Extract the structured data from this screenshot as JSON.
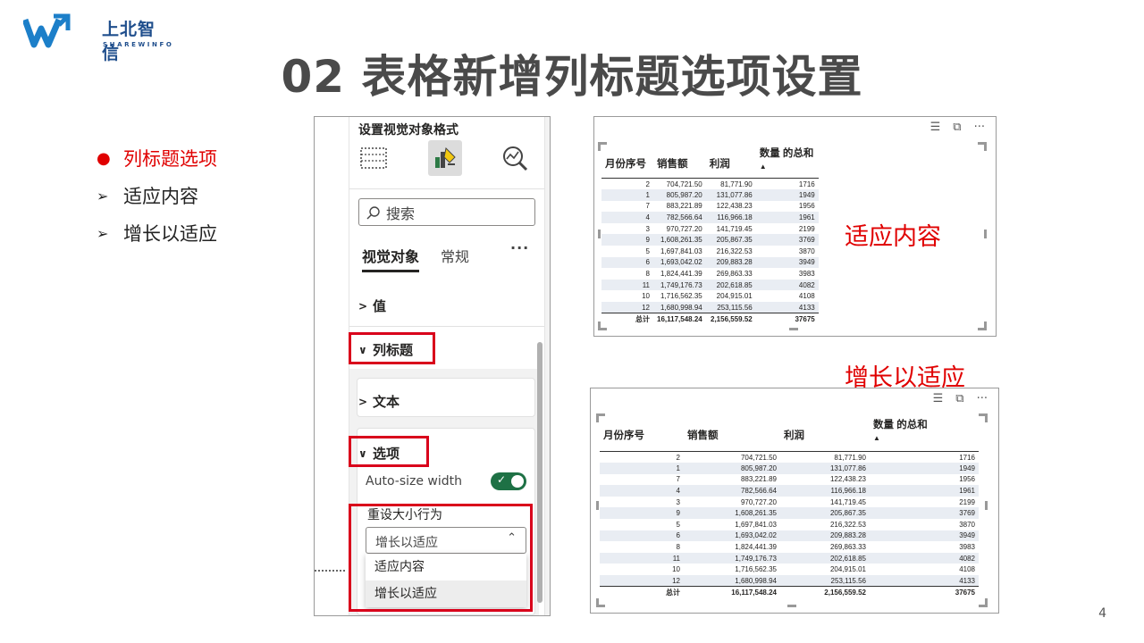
{
  "logo": {
    "cn": "上北智信",
    "en": "SHAREWINFO"
  },
  "title": "02 表格新增列标题选项设置",
  "bullets": [
    {
      "text": "列标题选项",
      "marker": "●",
      "active": true
    },
    {
      "text": "适应内容",
      "marker": "➢",
      "active": false
    },
    {
      "text": "增长以适应",
      "marker": "➢",
      "active": false
    }
  ],
  "pane": {
    "header": "设置视觉对象格式",
    "search_placeholder": "搜索",
    "tabs": {
      "visual": "视觉对象",
      "general": "常规",
      "more": "···"
    },
    "sections": {
      "values": "值",
      "column_headers": "列标题",
      "text": "文本",
      "options": "选项"
    },
    "auto_size_label": "Auto-size width",
    "auto_size_on": true,
    "resize_label": "重设大小行为",
    "resize_value": "增长以适应",
    "resize_options": [
      "适应内容",
      "增长以适应"
    ]
  },
  "table": {
    "headers": [
      "月份序号",
      "销售额",
      "利润",
      "数量 的总和"
    ],
    "rows": [
      [
        "2",
        "704,721.50",
        "81,771.90",
        "1716"
      ],
      [
        "1",
        "805,987.20",
        "131,077.86",
        "1949"
      ],
      [
        "7",
        "883,221.89",
        "122,438.23",
        "1956"
      ],
      [
        "4",
        "782,566.64",
        "116,966.18",
        "1961"
      ],
      [
        "3",
        "970,727.20",
        "141,719.45",
        "2199"
      ],
      [
        "9",
        "1,608,261.35",
        "205,867.35",
        "3769"
      ],
      [
        "5",
        "1,697,841.03",
        "216,322.53",
        "3870"
      ],
      [
        "6",
        "1,693,042.02",
        "209,883.28",
        "3949"
      ],
      [
        "8",
        "1,824,441.39",
        "269,863.33",
        "3983"
      ],
      [
        "11",
        "1,749,176.73",
        "202,618.85",
        "4082"
      ],
      [
        "10",
        "1,716,562.35",
        "204,915.01",
        "4108"
      ],
      [
        "12",
        "1,680,998.94",
        "253,115.56",
        "4133"
      ]
    ],
    "total": [
      "总计",
      "16,117,548.24",
      "2,156,559.52",
      "37675"
    ]
  },
  "labels": {
    "fit_content": "适应内容",
    "grow_to_fit": "增长以适应"
  },
  "visual_icons": {
    "filter": "filter-icon",
    "focus": "focus-mode-icon",
    "more": "more-options-icon"
  },
  "page_number": "4",
  "colors": {
    "accent_red": "#e00000",
    "toggle_green": "#1e7145",
    "title_gray": "#4a4a4a",
    "brand_blue": "#1f4e8c"
  }
}
